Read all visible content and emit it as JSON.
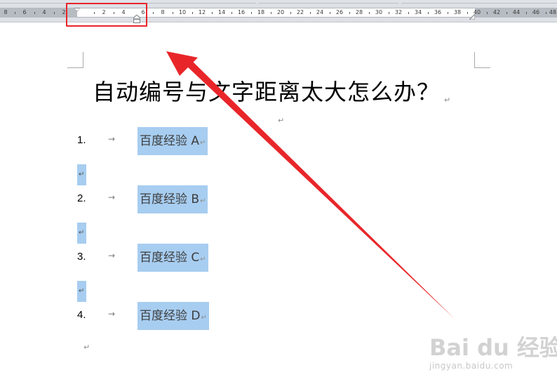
{
  "ruler": {
    "labels": [
      "8",
      "6",
      "4",
      "2",
      "2",
      "4",
      "6",
      "8",
      "10",
      "12",
      "14",
      "16",
      "18",
      "20",
      "22",
      "24",
      "26",
      "28",
      "30",
      "32",
      "34",
      "36",
      "38",
      "40",
      "42",
      "44",
      "46",
      "48"
    ]
  },
  "document": {
    "title": "自动编号与文字距离太大怎么办？",
    "paragraph_mark": "↵",
    "tab_arrow": "→",
    "list_items": [
      {
        "number": "1.",
        "text": "百度经验 A"
      },
      {
        "number": "2.",
        "text": "百度经验 B"
      },
      {
        "number": "3.",
        "text": "百度经验 C"
      },
      {
        "number": "4.",
        "text": "百度经验 D"
      }
    ]
  },
  "watermark": {
    "logo_text": "Bai du 经验",
    "url_text": "jingyan.baidu.com"
  },
  "colors": {
    "annotation_red": "#e8262a",
    "selection_blue": "#a7cdf0"
  }
}
